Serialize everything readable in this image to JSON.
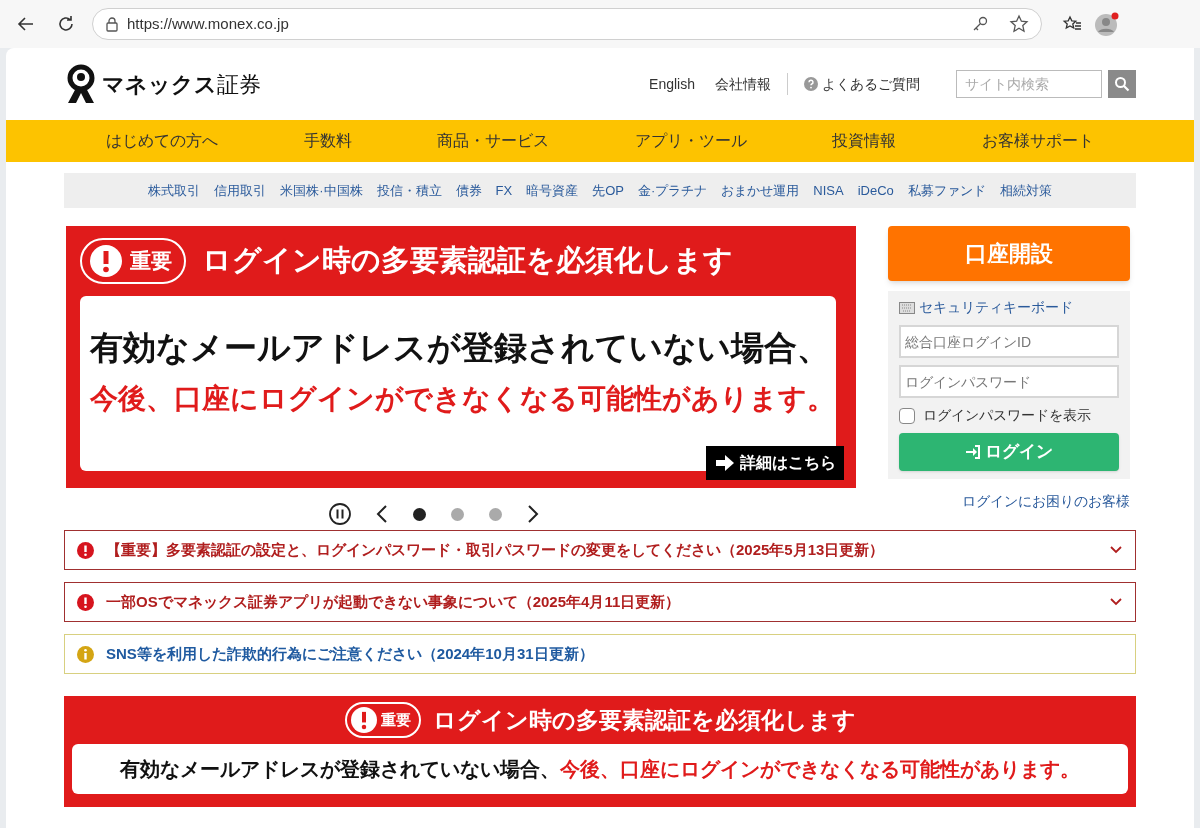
{
  "browser": {
    "url": "https://www.monex.co.jp"
  },
  "header": {
    "logo": "**マネックス**証券",
    "links": [
      "English",
      "会社情報"
    ],
    "faq": "よくあるご質問",
    "search": {
      "placeholder": "サイト内検索"
    }
  },
  "main_nav": [
    "はじめての方へ",
    "手数料",
    "商品・サービス",
    "アプリ・ツール",
    "投資情報",
    "お客様サポート"
  ],
  "sub_nav": [
    "株式取引",
    "信用取引",
    "米国株·中国株",
    "投信・積立",
    "債券",
    "FX",
    "暗号資産",
    "先OP",
    "金·プラチナ",
    "おまかせ運用",
    "NISA",
    "iDeCo",
    "私募ファンド",
    "相続対策"
  ],
  "banner": {
    "badge": "重要",
    "title": "ログイン時の多要素認証を必須化します",
    "line_1": "有効なメールアドレスが登録されていない場合、",
    "line_2": "今後、口座にログインができなくなる可能性があります。",
    "button": "詳細はこちら"
  },
  "carousel": {
    "dots": [
      {
        "selected": true
      },
      {
        "selected": false
      },
      {
        "selected": false
      }
    ]
  },
  "login": {
    "open_account": "口座開設",
    "security_keyboard": "セキュリティキーボード",
    "id": {
      "placeholder": "総合口座ログインID"
    },
    "password": {
      "placeholder": "ログインパスワード"
    },
    "show_password": {
      "label": "ログインパスワードを表示",
      "checked": false
    },
    "login_button": "ログイン",
    "help": "ログインにお困りのお客様"
  },
  "notices": [
    {
      "kind": "alert",
      "text": "【重要】多要素認証の設定と、ログインパスワード・取引パスワードの変更をしてください（2025年5月13日更新）",
      "expandable": true
    },
    {
      "kind": "alert",
      "text": "一部OSでマネックス証券アプリが起動できない事象について（2025年4月11日更新）",
      "expandable": true
    },
    {
      "kind": "info",
      "text": "SNS等を利用した詐欺的行為にご注意ください（2024年10月31日更新）",
      "expandable": false
    }
  ],
  "bottom_banner": {
    "badge": "重要",
    "title": "ログイン時の多要素認証を必須化します",
    "message": "有効なメールアドレスが登録されていない場合、",
    "warning": "今後、口座にログインができなくなる可能性があります。"
  }
}
